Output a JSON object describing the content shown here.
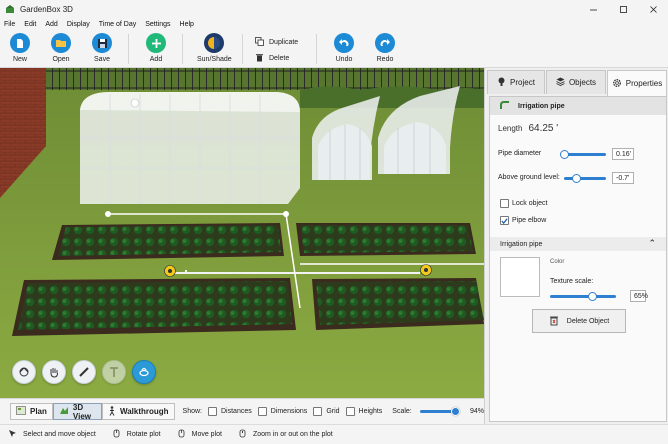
{
  "window": {
    "title": "GardenBox 3D",
    "icon": "garden-logo-icon",
    "controls": [
      "minimize-icon",
      "maximize-icon",
      "close-icon"
    ]
  },
  "menu": [
    "File",
    "Edit",
    "Add",
    "Display",
    "Time of Day",
    "Settings",
    "Help"
  ],
  "toolbar": {
    "new_label": "New",
    "open_label": "Open",
    "save_label": "Save",
    "add_label": "Add",
    "sunshade_label": "Sun/Shade",
    "duplicate_label": "Duplicate",
    "delete_label": "Delete",
    "undo_label": "Undo",
    "redo_label": "Redo"
  },
  "view": {
    "tabs": [
      {
        "label": "Plan",
        "icon": "plan-icon",
        "active": false
      },
      {
        "label": "3D View",
        "icon": "3d-view-icon",
        "active": true
      },
      {
        "label": "Walkthrough",
        "icon": "walker-icon",
        "active": false
      }
    ],
    "show_label": "Show:",
    "options": [
      {
        "label": "Distances",
        "checked": false
      },
      {
        "label": "Dimensions",
        "checked": false
      },
      {
        "label": "Grid",
        "checked": false
      },
      {
        "label": "Heights",
        "checked": false
      }
    ],
    "scale_label": "Scale:",
    "scale_value": "94%",
    "scale_fraction": 0.94
  },
  "tool_circles": [
    {
      "icon": "rotate-camera-icon",
      "active": false,
      "disabled": false
    },
    {
      "icon": "hand-pan-icon",
      "active": false,
      "disabled": false
    },
    {
      "icon": "ruler-icon",
      "active": false,
      "disabled": false
    },
    {
      "icon": "text-tool-icon",
      "active": false,
      "disabled": true
    },
    {
      "icon": "irrigation-tool-icon",
      "active": true,
      "disabled": false
    }
  ],
  "status": [
    {
      "icon": "select-move-icon",
      "label": "Select and move object"
    },
    {
      "icon": "rotate-plot-icon",
      "label": "Rotate plot"
    },
    {
      "icon": "move-plot-icon",
      "label": "Move plot"
    },
    {
      "icon": "zoom-plot-icon",
      "label": "Zoom in or out on the plot"
    }
  ],
  "panel": {
    "tabs": [
      {
        "label": "Project",
        "icon": "project-icon",
        "active": false
      },
      {
        "label": "Objects",
        "icon": "layers-icon",
        "active": false
      },
      {
        "label": "Properties",
        "icon": "gear-icon",
        "active": true
      }
    ],
    "object_name": "Irrigation pipe",
    "object_icon": "irrigation-pipe-icon",
    "length_label": "Length",
    "length_value": "64.25 '",
    "pipe_diameter_label": "Pipe diameter",
    "pipe_diameter_value": "0.16'",
    "pipe_diameter_fraction": 0.05,
    "above_ground_label": "Above ground level:",
    "above_ground_value": "-0.7'",
    "above_ground_fraction": 0.3,
    "lock_object_label": "Lock object",
    "lock_object_checked": false,
    "pipe_elbow_label": "Pipe elbow",
    "pipe_elbow_checked": true,
    "section_title": "Irrigation pipe",
    "color_label": "Color",
    "color_value": "#ffffff",
    "texture_scale_label": "Texture scale:",
    "texture_scale_value": "65%",
    "texture_scale_fraction": 0.65,
    "delete_label": "Delete Object"
  },
  "colors": {
    "accent": "#2d9ad8",
    "grass": "#7fa23a",
    "soil": "#3b2a1e",
    "toolbar_green": "#21b97a",
    "toolbar_blue": "#1d8ad6",
    "toolbar_gold": "#f0b31e"
  }
}
